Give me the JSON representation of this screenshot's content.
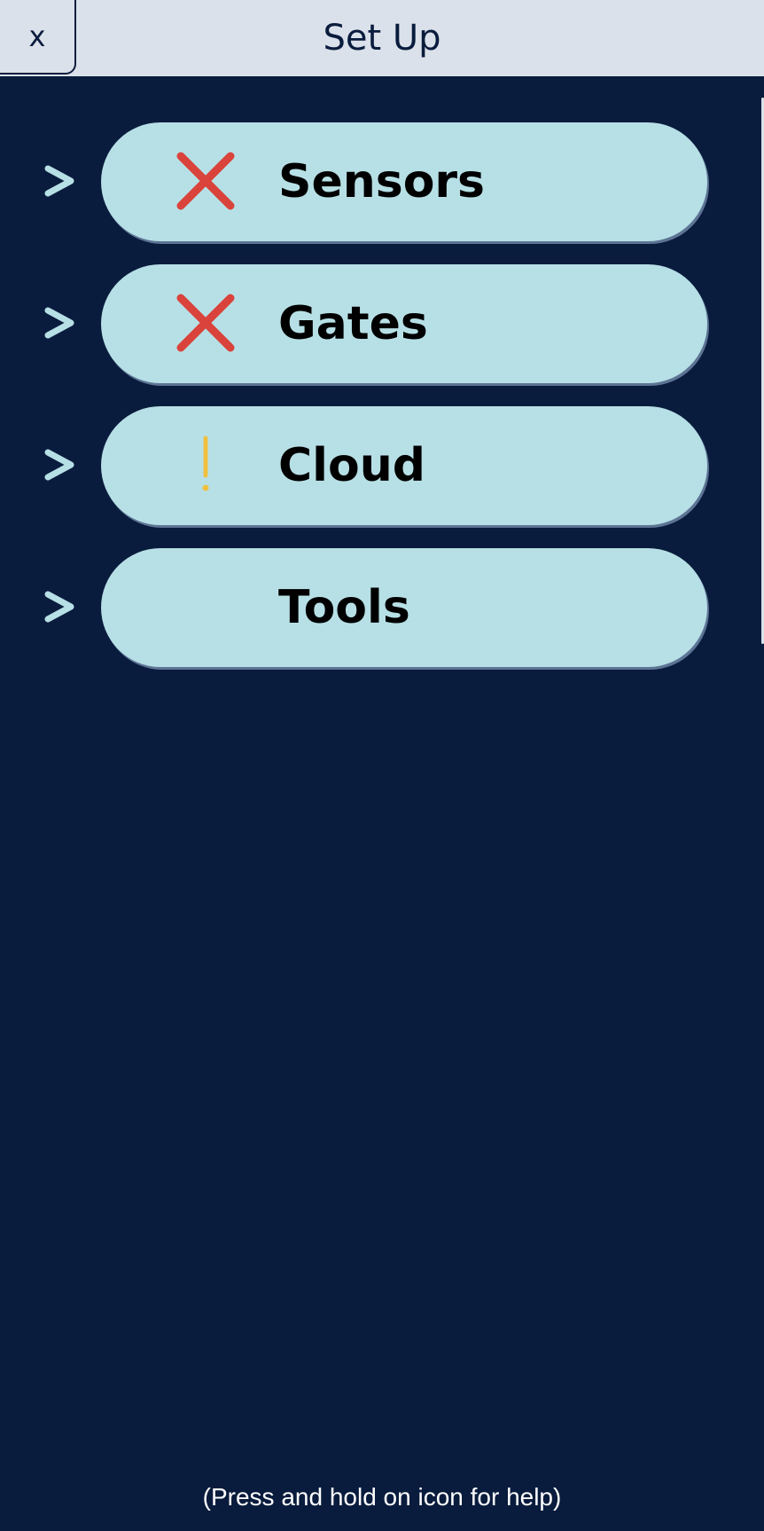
{
  "header": {
    "close_label": "x",
    "title": "Set Up"
  },
  "menu": {
    "items": [
      {
        "label": "Sensors",
        "status": "error",
        "status_icon": "x-mark-icon"
      },
      {
        "label": "Gates",
        "status": "error",
        "status_icon": "x-mark-icon"
      },
      {
        "label": "Cloud",
        "status": "warning",
        "status_icon": "exclamation-icon"
      },
      {
        "label": "Tools",
        "status": "none",
        "status_icon": ""
      }
    ],
    "chevron_label": ">"
  },
  "footer": {
    "help_text": "(Press and hold on icon for help)"
  },
  "colors": {
    "background": "#0a1c3d",
    "header": "#dbe1ea",
    "pill": "#b7e0e6",
    "chevron": "#b7e0e6",
    "error": "#d9433b",
    "warning": "#f0c040"
  }
}
